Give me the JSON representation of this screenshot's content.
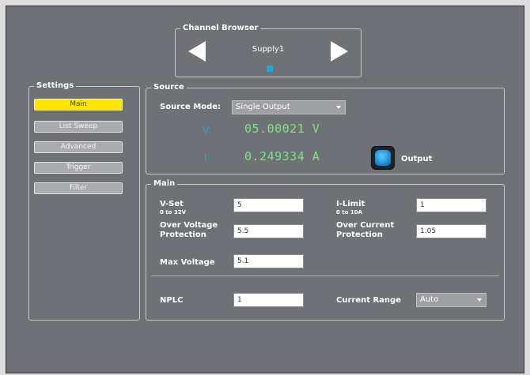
{
  "channel_browser": {
    "title": "Channel Browser",
    "supply_name": "Supply1"
  },
  "settings": {
    "title": "Settings",
    "buttons": [
      "Main",
      "List Sweep",
      "Advanced",
      "Trigger",
      "Filter"
    ],
    "active": "Main"
  },
  "source": {
    "title": "Source",
    "mode_label": "Source Mode:",
    "mode_value": "Single Output",
    "v_label": "V:",
    "v_value": "05.00021 V",
    "i_label": "I:",
    "i_value": "0.249334 A",
    "output_label": "Output"
  },
  "main": {
    "title": "Main",
    "vset_label": "V-Set",
    "vset_range": "0 to 32V",
    "vset_value": "5",
    "ilimit_label": "I-Limit",
    "ilimit_range": "0 to 10A",
    "ilimit_value": "1",
    "ovp_label_1": "Over Voltage",
    "ovp_label_2": "Protection",
    "ovp_value": "5.5",
    "ocp_label_1": "Over Current",
    "ocp_label_2": "Protection",
    "ocp_value": "1.05",
    "maxv_label": "Max Voltage",
    "maxv_value": "5.1",
    "nplc_label": "NPLC",
    "nplc_value": "1",
    "current_range_label": "Current Range",
    "current_range_value": "Auto"
  },
  "colors": {
    "panel_bg": "#6e7176",
    "active_button": "#ffe600",
    "readout_green": "#7fe37f",
    "label_blue": "#29a3e0"
  }
}
